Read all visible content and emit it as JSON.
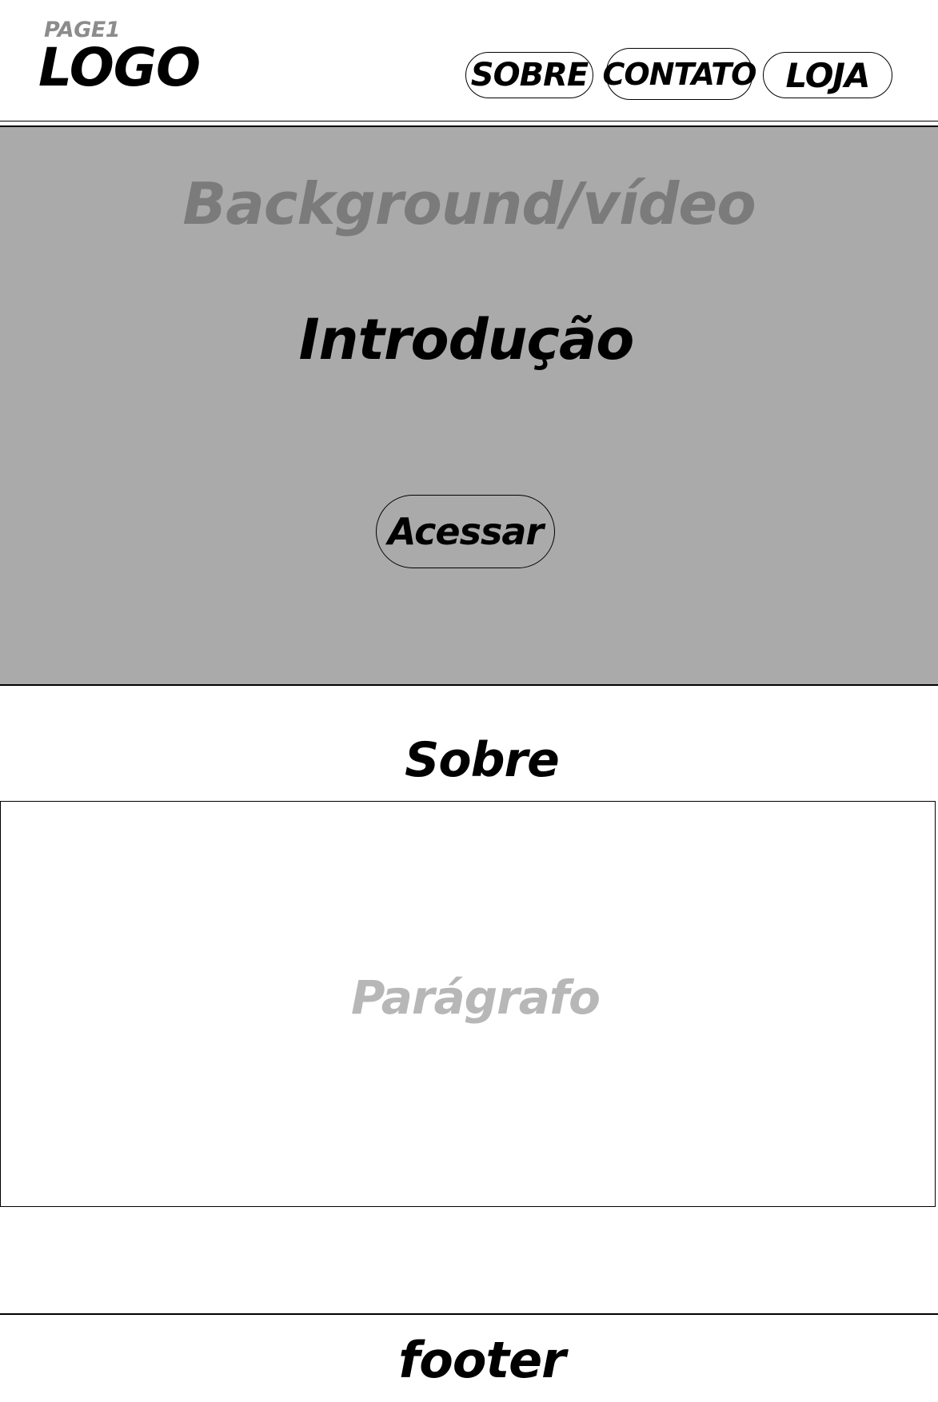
{
  "header": {
    "page_label": "PAGE1",
    "logo": "LOGO",
    "nav": {
      "sobre": "SOBRE",
      "contato": "CONTATO",
      "loja": "LOJA"
    }
  },
  "hero": {
    "background_label": "Background/vídeo",
    "title": "Introdução",
    "cta_label": "Acessar"
  },
  "about": {
    "title": "Sobre",
    "paragraph_placeholder": "Parágrafo"
  },
  "footer": {
    "label": "footer"
  },
  "colors": {
    "hero_background": "#aaaaaa",
    "background_label_text": "#7b7b7b",
    "page_label_text": "#8c8c8c",
    "paragraph_placeholder_text": "#b7b7b7",
    "ink": "#000000"
  }
}
